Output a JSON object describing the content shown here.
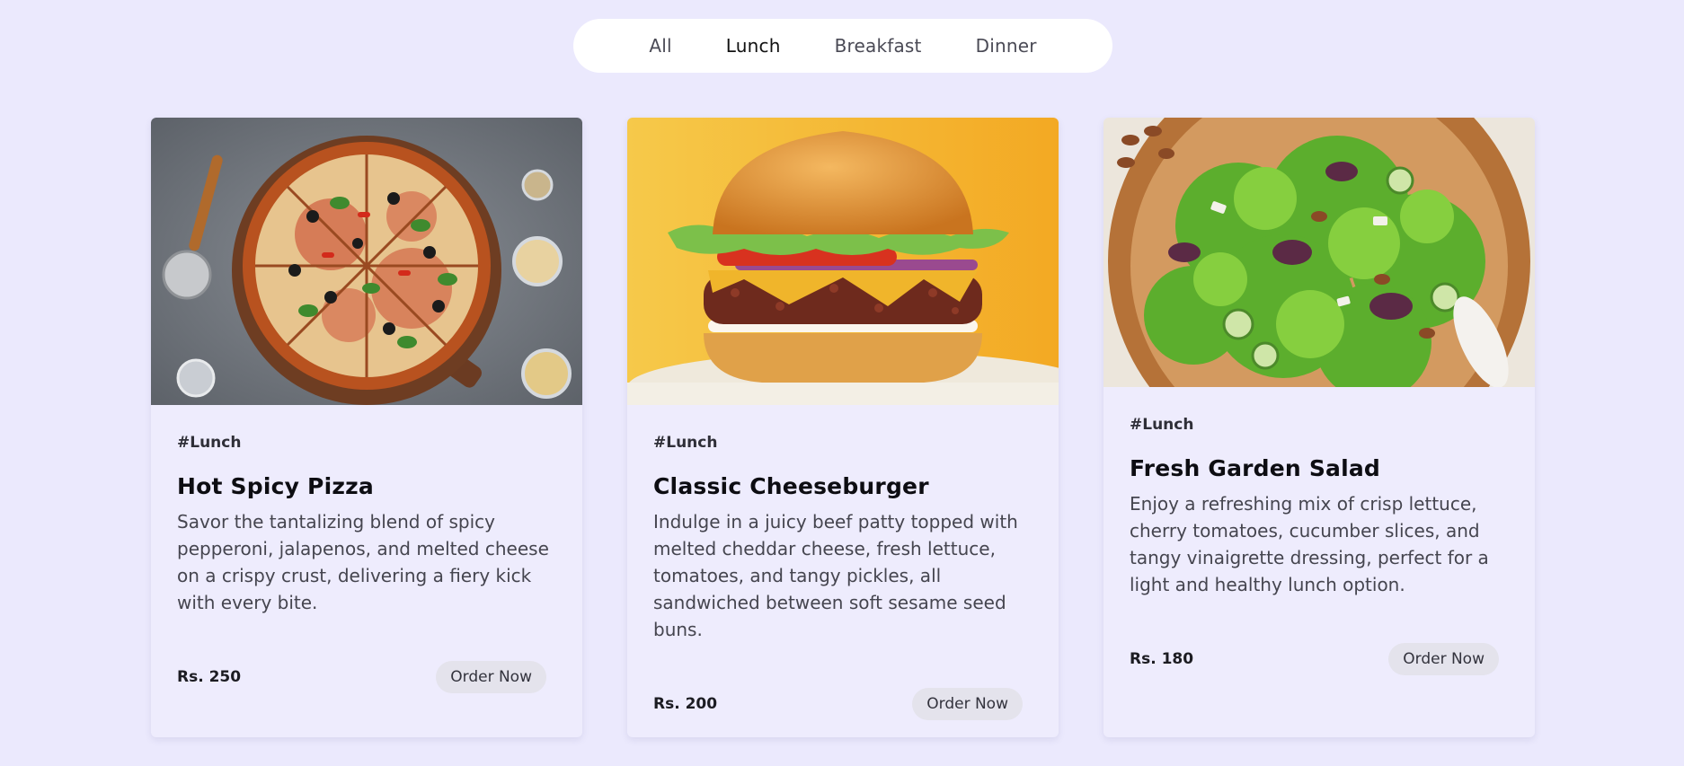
{
  "filters": {
    "tabs": [
      {
        "label": "All",
        "active": false
      },
      {
        "label": "Lunch",
        "active": true
      },
      {
        "label": "Breakfast",
        "active": false
      },
      {
        "label": "Dinner",
        "active": false
      }
    ]
  },
  "cards": [
    {
      "image_icon": "pizza-image",
      "tag": "#Lunch",
      "title": "Hot Spicy Pizza",
      "description": "Savor the tantalizing blend of spicy pepperoni, jalapenos, and melted cheese on a crispy crust, delivering a fiery kick with every bite.",
      "price": "Rs. 250",
      "button_label": "Order Now"
    },
    {
      "image_icon": "cheeseburger-image",
      "tag": "#Lunch",
      "title": "Classic Cheeseburger",
      "description": "Indulge in a juicy beef patty topped with melted cheddar cheese, fresh lettuce, tomatoes, and tangy pickles, all sandwiched between soft sesame seed buns.",
      "price": "Rs. 200",
      "button_label": "Order Now"
    },
    {
      "image_icon": "salad-image",
      "tag": "#Lunch",
      "title": "Fresh Garden Salad",
      "description": "Enjoy a refreshing mix of crisp lettuce, cherry tomatoes, cucumber slices, and tangy vinaigrette dressing, perfect for a light and healthy lunch option.",
      "price": "Rs. 180",
      "button_label": "Order Now"
    }
  ],
  "colors": {
    "page_background": "#ebe9fd",
    "card_background": "#eeecfd",
    "filter_bar": "#ffffff",
    "button_background": "#e4e3ec"
  }
}
